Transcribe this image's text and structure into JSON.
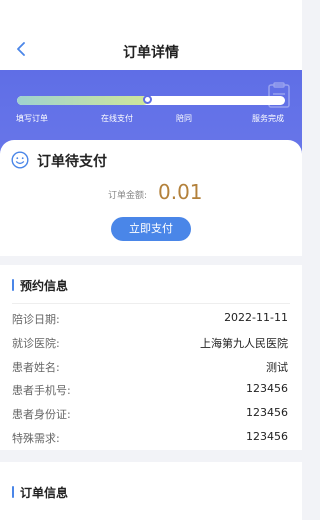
{
  "header": {
    "title": "订单详情",
    "back_icon": "chevron-left-icon"
  },
  "progress": {
    "steps": [
      "填写订单",
      "在线支付",
      "陪同",
      "服务完成"
    ],
    "current_step": "在线支付",
    "fraction": 0.49
  },
  "status": {
    "title": "订单待支付",
    "amount_label": "订单金额:",
    "amount_value": "0.01",
    "pay_label": "立即支付"
  },
  "info": {
    "section_title": "预约信息",
    "rows": [
      {
        "label": "陪诊日期:",
        "value": "2022-11-11"
      },
      {
        "label": "就诊医院:",
        "value": "上海第九人民医院"
      },
      {
        "label": "患者姓名:",
        "value": "测试"
      },
      {
        "label": "患者手机号:",
        "value": "123456"
      },
      {
        "label": "患者身份证:",
        "value": "123456"
      },
      {
        "label": "特殊需求:",
        "value": "123456"
      }
    ]
  },
  "next_section": {
    "title": "订单信息"
  },
  "colors": {
    "accent": "#4a86e8",
    "band": "#5f6ee6",
    "amount": "#b3813b",
    "background": "#f2f3f7"
  }
}
